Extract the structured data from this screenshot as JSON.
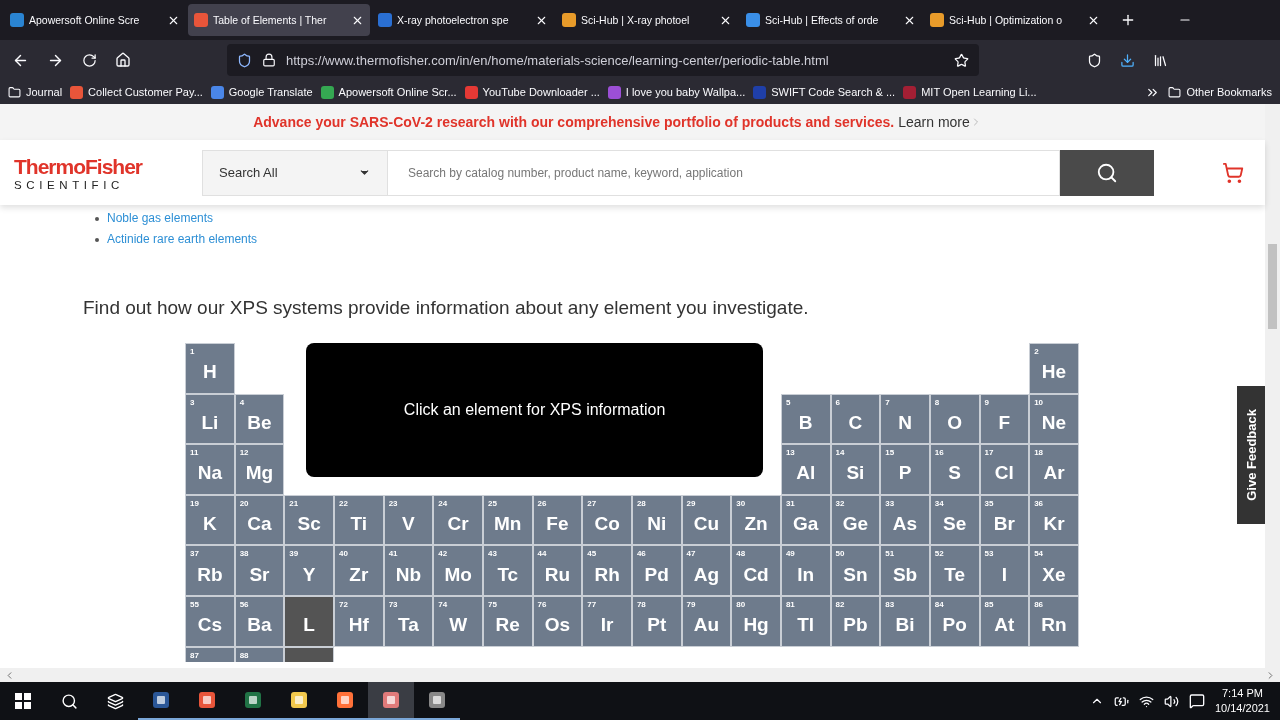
{
  "tabs": [
    {
      "title": "Apowersoft Online Scre",
      "selected": false
    },
    {
      "title": "Table of Elements | Ther",
      "selected": true
    },
    {
      "title": "X-ray photoelectron spe",
      "selected": false
    },
    {
      "title": "Sci-Hub | X-ray photoel",
      "selected": false
    },
    {
      "title": "Sci-Hub | Effects of orde",
      "selected": false
    },
    {
      "title": "Sci-Hub | Optimization o",
      "selected": false
    }
  ],
  "address": {
    "url": "https://www.thermofisher.com/in/en/home/materials-science/learning-center/periodic-table.html"
  },
  "bookmarks": [
    {
      "kind": "folder",
      "label": "Journal"
    },
    {
      "kind": "site",
      "label": "Collect Customer Pay...",
      "color": "#e8553a"
    },
    {
      "kind": "site",
      "label": "Google Translate",
      "color": "#4a86e8"
    },
    {
      "kind": "site",
      "label": "Apowersoft Online Scr...",
      "color": "#35a852"
    },
    {
      "kind": "site",
      "label": "YouTube Downloader ...",
      "color": "#e53935"
    },
    {
      "kind": "site",
      "label": "I love you baby Wallpa...",
      "color": "#9c4fd6"
    },
    {
      "kind": "site",
      "label": "SWIFT Code Search & ...",
      "color": "#1f3fa8"
    },
    {
      "kind": "site",
      "label": "MIT Open Learning Li...",
      "color": "#a31f34"
    }
  ],
  "other_bookmarks": "Other Bookmarks",
  "banner": {
    "text": "Advance your SARS-CoV-2 research with our comprehensive portfolio of products and services.",
    "link": "Learn more"
  },
  "header": {
    "logo_top": "ThermoFisher",
    "logo_bottom": "SCIENTIFIC",
    "search_scope": "Search All",
    "search_placeholder": "Search by catalog number, product name, keyword, application"
  },
  "links": [
    "Noble gas elements",
    "Actinide rare earth elements"
  ],
  "heading": "Find out how our XPS systems provide information about any element you investigate.",
  "info_box": "Click an element for XPS information",
  "periods": [
    [
      {
        "kind": "element",
        "number": "1",
        "symbol": "H"
      },
      {
        "kind": "gap"
      },
      {
        "kind": "gap"
      },
      {
        "kind": "gap"
      },
      {
        "kind": "gap"
      },
      {
        "kind": "gap"
      },
      {
        "kind": "gap"
      },
      {
        "kind": "gap"
      },
      {
        "kind": "gap"
      },
      {
        "kind": "gap"
      },
      {
        "kind": "gap"
      },
      {
        "kind": "gap"
      },
      {
        "kind": "gap"
      },
      {
        "kind": "gap"
      },
      {
        "kind": "gap"
      },
      {
        "kind": "gap"
      },
      {
        "kind": "gap"
      },
      {
        "kind": "element",
        "number": "2",
        "symbol": "He"
      }
    ],
    [
      {
        "kind": "element",
        "number": "3",
        "symbol": "Li"
      },
      {
        "kind": "element",
        "number": "4",
        "symbol": "Be"
      },
      {
        "kind": "gap"
      },
      {
        "kind": "gap"
      },
      {
        "kind": "gap"
      },
      {
        "kind": "gap"
      },
      {
        "kind": "gap"
      },
      {
        "kind": "gap"
      },
      {
        "kind": "gap"
      },
      {
        "kind": "gap"
      },
      {
        "kind": "gap"
      },
      {
        "kind": "gap"
      },
      {
        "kind": "element",
        "number": "5",
        "symbol": "B"
      },
      {
        "kind": "element",
        "number": "6",
        "symbol": "C"
      },
      {
        "kind": "element",
        "number": "7",
        "symbol": "N"
      },
      {
        "kind": "element",
        "number": "8",
        "symbol": "O"
      },
      {
        "kind": "element",
        "number": "9",
        "symbol": "F"
      },
      {
        "kind": "element",
        "number": "10",
        "symbol": "Ne"
      }
    ],
    [
      {
        "kind": "element",
        "number": "11",
        "symbol": "Na"
      },
      {
        "kind": "element",
        "number": "12",
        "symbol": "Mg"
      },
      {
        "kind": "gap"
      },
      {
        "kind": "gap"
      },
      {
        "kind": "gap"
      },
      {
        "kind": "gap"
      },
      {
        "kind": "gap"
      },
      {
        "kind": "gap"
      },
      {
        "kind": "gap"
      },
      {
        "kind": "gap"
      },
      {
        "kind": "gap"
      },
      {
        "kind": "gap"
      },
      {
        "kind": "element",
        "number": "13",
        "symbol": "Al"
      },
      {
        "kind": "element",
        "number": "14",
        "symbol": "Si"
      },
      {
        "kind": "element",
        "number": "15",
        "symbol": "P"
      },
      {
        "kind": "element",
        "number": "16",
        "symbol": "S"
      },
      {
        "kind": "element",
        "number": "17",
        "symbol": "Cl"
      },
      {
        "kind": "element",
        "number": "18",
        "symbol": "Ar"
      }
    ],
    [
      {
        "kind": "element",
        "number": "19",
        "symbol": "K"
      },
      {
        "kind": "element",
        "number": "20",
        "symbol": "Ca"
      },
      {
        "kind": "element",
        "number": "21",
        "symbol": "Sc"
      },
      {
        "kind": "element",
        "number": "22",
        "symbol": "Ti"
      },
      {
        "kind": "element",
        "number": "23",
        "symbol": "V"
      },
      {
        "kind": "element",
        "number": "24",
        "symbol": "Cr"
      },
      {
        "kind": "element",
        "number": "25",
        "symbol": "Mn"
      },
      {
        "kind": "element",
        "number": "26",
        "symbol": "Fe"
      },
      {
        "kind": "element",
        "number": "27",
        "symbol": "Co"
      },
      {
        "kind": "element",
        "number": "28",
        "symbol": "Ni"
      },
      {
        "kind": "element",
        "number": "29",
        "symbol": "Cu"
      },
      {
        "kind": "element",
        "number": "30",
        "symbol": "Zn"
      },
      {
        "kind": "element",
        "number": "31",
        "symbol": "Ga"
      },
      {
        "kind": "element",
        "number": "32",
        "symbol": "Ge"
      },
      {
        "kind": "element",
        "number": "33",
        "symbol": "As"
      },
      {
        "kind": "element",
        "number": "34",
        "symbol": "Se"
      },
      {
        "kind": "element",
        "number": "35",
        "symbol": "Br"
      },
      {
        "kind": "element",
        "number": "36",
        "symbol": "Kr"
      }
    ],
    [
      {
        "kind": "element",
        "number": "37",
        "symbol": "Rb"
      },
      {
        "kind": "element",
        "number": "38",
        "symbol": "Sr"
      },
      {
        "kind": "element",
        "number": "39",
        "symbol": "Y"
      },
      {
        "kind": "element",
        "number": "40",
        "symbol": "Zr"
      },
      {
        "kind": "element",
        "number": "41",
        "symbol": "Nb"
      },
      {
        "kind": "element",
        "number": "42",
        "symbol": "Mo"
      },
      {
        "kind": "element",
        "number": "43",
        "symbol": "Tc"
      },
      {
        "kind": "element",
        "number": "44",
        "symbol": "Ru"
      },
      {
        "kind": "element",
        "number": "45",
        "symbol": "Rh"
      },
      {
        "kind": "element",
        "number": "46",
        "symbol": "Pd"
      },
      {
        "kind": "element",
        "number": "47",
        "symbol": "Ag"
      },
      {
        "kind": "element",
        "number": "48",
        "symbol": "Cd"
      },
      {
        "kind": "element",
        "number": "49",
        "symbol": "In"
      },
      {
        "kind": "element",
        "number": "50",
        "symbol": "Sn"
      },
      {
        "kind": "element",
        "number": "51",
        "symbol": "Sb"
      },
      {
        "kind": "element",
        "number": "52",
        "symbol": "Te"
      },
      {
        "kind": "element",
        "number": "53",
        "symbol": "I"
      },
      {
        "kind": "element",
        "number": "54",
        "symbol": "Xe"
      }
    ],
    [
      {
        "kind": "element",
        "number": "55",
        "symbol": "Cs"
      },
      {
        "kind": "element",
        "number": "56",
        "symbol": "Ba"
      },
      {
        "kind": "series",
        "symbol": "L"
      },
      {
        "kind": "element",
        "number": "72",
        "symbol": "Hf"
      },
      {
        "kind": "element",
        "number": "73",
        "symbol": "Ta"
      },
      {
        "kind": "element",
        "number": "74",
        "symbol": "W"
      },
      {
        "kind": "element",
        "number": "75",
        "symbol": "Re"
      },
      {
        "kind": "element",
        "number": "76",
        "symbol": "Os"
      },
      {
        "kind": "element",
        "number": "77",
        "symbol": "Ir"
      },
      {
        "kind": "element",
        "number": "78",
        "symbol": "Pt"
      },
      {
        "kind": "element",
        "number": "79",
        "symbol": "Au"
      },
      {
        "kind": "element",
        "number": "80",
        "symbol": "Hg"
      },
      {
        "kind": "element",
        "number": "81",
        "symbol": "Tl"
      },
      {
        "kind": "element",
        "number": "82",
        "symbol": "Pb"
      },
      {
        "kind": "element",
        "number": "83",
        "symbol": "Bi"
      },
      {
        "kind": "element",
        "number": "84",
        "symbol": "Po"
      },
      {
        "kind": "element",
        "number": "85",
        "symbol": "At"
      },
      {
        "kind": "element",
        "number": "86",
        "symbol": "Rn"
      }
    ],
    [
      {
        "kind": "element",
        "number": "87"
      },
      {
        "kind": "element",
        "number": "88"
      },
      {
        "kind": "series"
      }
    ]
  ],
  "feedback": "Give Feedback",
  "taskbar": {
    "apps": [
      {
        "selected": false
      },
      {
        "selected": false
      },
      {
        "selected": false
      },
      {
        "selected": false
      },
      {
        "selected": false
      },
      {
        "selected": true
      },
      {
        "selected": false
      }
    ],
    "time": "7:14 PM",
    "date": "10/14/2021"
  }
}
